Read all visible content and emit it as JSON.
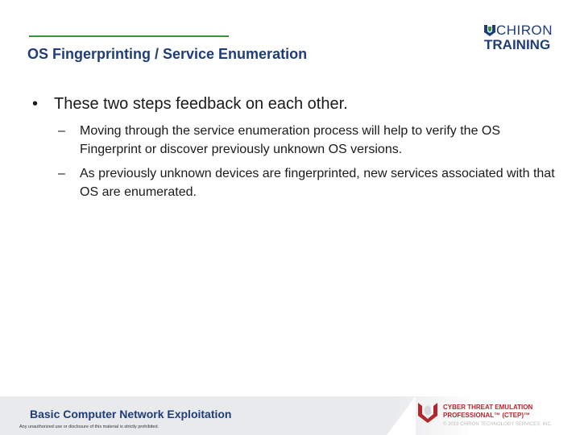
{
  "header": {
    "title": "OS Fingerprinting / Service Enumeration",
    "logo": {
      "line1": "CHIRON",
      "line2": "TRAINING",
      "icon": "chiron-shield-icon"
    }
  },
  "body": {
    "bullet": "These two steps feedback on each other.",
    "bullet_marker": "•",
    "sub_marker": "–",
    "sub_bullets": [
      "Moving through the service enumeration process will help to verify the OS Fingerprint or discover previously unknown OS versions.",
      "As previously unknown devices are fingerprinted, new services associated with that OS are enumerated."
    ]
  },
  "footer": {
    "course_title": "Basic Computer Network Exploitation",
    "legal": "Any unauthorized use or disclosure of this material is strictly prohibited.",
    "ctep_line1": "CYBER THREAT EMULATION",
    "ctep_line2": "PROFESSIONAL™ (CTEP)™",
    "copyright": "© 2019 CHIRON TECHNOLOGY SERVICES, INC.",
    "ctep_icon": "ctep-shield-icon"
  },
  "colors": {
    "title_blue": "#1f3d7a",
    "rule_green": "#3f8f3a",
    "ctep_red": "#b5252b",
    "footer_gray": "#e9eaec"
  }
}
